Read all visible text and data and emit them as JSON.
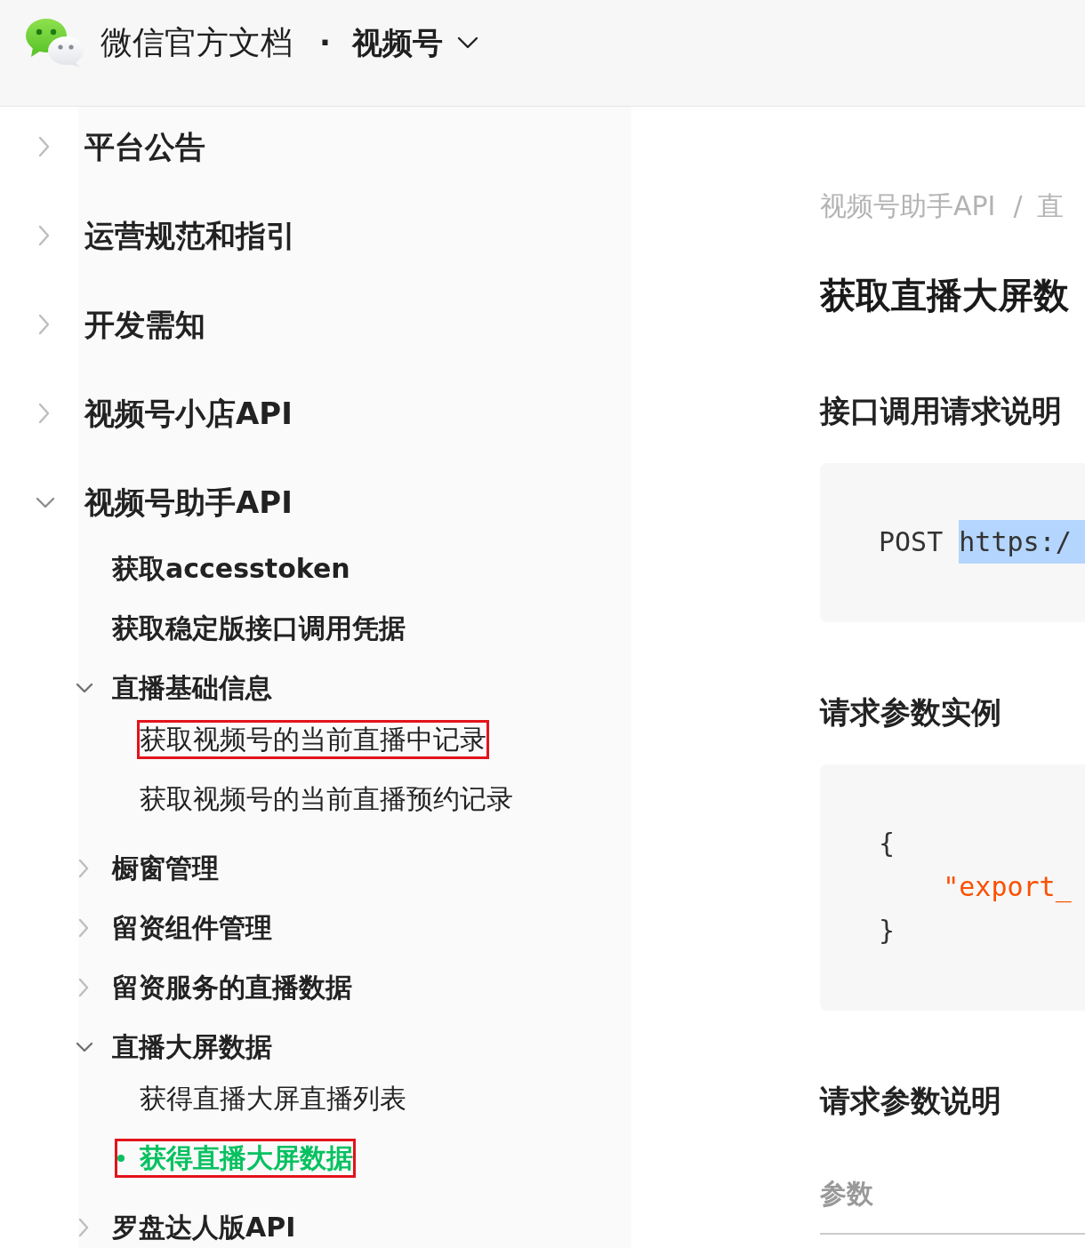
{
  "header": {
    "site_title": "微信官方文档",
    "separator": "·",
    "section": "视频号"
  },
  "sidebar": {
    "items": [
      {
        "kind": "group",
        "label": "平台公告",
        "expanded": false,
        "selected": false,
        "marked": false
      },
      {
        "kind": "group",
        "label": "运营规范和指引",
        "expanded": false,
        "selected": false,
        "marked": false
      },
      {
        "kind": "group",
        "label": "开发需知",
        "expanded": false,
        "selected": false,
        "marked": false
      },
      {
        "kind": "group",
        "label": "视频号小店API",
        "expanded": false,
        "selected": false,
        "marked": false
      },
      {
        "kind": "group",
        "label": "视频号助手API",
        "expanded": true,
        "selected": false,
        "marked": false,
        "children": [
          {
            "kind": "page",
            "label": "获取accesstoken",
            "selected": false,
            "marked": false
          },
          {
            "kind": "page",
            "label": "获取稳定版接口调用凭据",
            "selected": false,
            "marked": false
          },
          {
            "kind": "group",
            "label": "直播基础信息",
            "expanded": true,
            "selected": false,
            "marked": false,
            "children": [
              {
                "kind": "page",
                "label": "获取视频号的当前直播中记录",
                "selected": false,
                "marked": true
              },
              {
                "kind": "page",
                "label": "获取视频号的当前直播预约记录",
                "selected": false,
                "marked": false
              }
            ]
          },
          {
            "kind": "group",
            "label": "橱窗管理",
            "expanded": false,
            "selected": false,
            "marked": false
          },
          {
            "kind": "group",
            "label": "留资组件管理",
            "expanded": false,
            "selected": false,
            "marked": false
          },
          {
            "kind": "group",
            "label": "留资服务的直播数据",
            "expanded": false,
            "selected": false,
            "marked": false
          },
          {
            "kind": "group",
            "label": "直播大屏数据",
            "expanded": true,
            "selected": false,
            "marked": false,
            "children": [
              {
                "kind": "page",
                "label": "获得直播大屏直播列表",
                "selected": false,
                "marked": false
              },
              {
                "kind": "page",
                "label": "获得直播大屏数据",
                "selected": true,
                "marked": true
              }
            ]
          },
          {
            "kind": "group",
            "label": "罗盘达人版API",
            "expanded": false,
            "selected": false,
            "marked": false
          }
        ]
      }
    ]
  },
  "content": {
    "breadcrumb": {
      "items": [
        "视频号助手API",
        "直"
      ],
      "separator": "/"
    },
    "title": "获取直播大屏数",
    "sections": [
      {
        "kind": "code",
        "heading": "接口调用请求说明",
        "lines": [
          [
            {
              "kind": "keyword",
              "text": "POST",
              "highlighted": false
            },
            {
              "kind": "plain",
              "text": "https:/",
              "highlighted": true
            }
          ]
        ]
      },
      {
        "kind": "code",
        "heading": "请求参数实例",
        "lines": [
          [
            {
              "kind": "punctuation",
              "text": "{",
              "highlighted": false
            }
          ],
          [
            {
              "kind": "string",
              "text": "    \"export_",
              "highlighted": false
            }
          ],
          [
            {
              "kind": "punctuation",
              "text": "}",
              "highlighted": false
            }
          ]
        ]
      },
      {
        "kind": "table",
        "heading": "请求参数说明",
        "columns": [
          "参数"
        ]
      }
    ]
  }
}
